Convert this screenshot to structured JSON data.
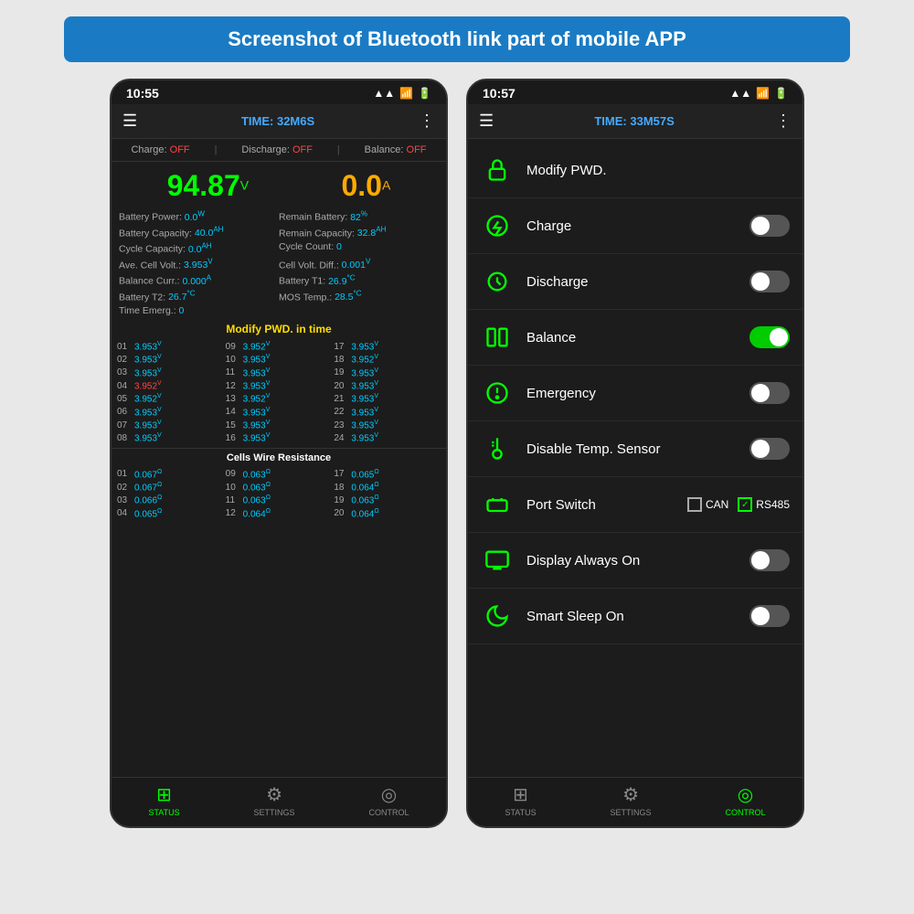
{
  "banner": {
    "text": "Screenshot of Bluetooth link part of mobile APP"
  },
  "phone_left": {
    "status_bar": {
      "time": "10:55",
      "signal": "▲▲",
      "wifi": "WiFi",
      "battery": "🔋"
    },
    "header": {
      "menu": "☰",
      "title": "TIME: 32M6S",
      "more": "⋮"
    },
    "status_indicators": [
      {
        "label": "Charge:",
        "value": "OFF"
      },
      {
        "label": "Discharge:",
        "value": "OFF"
      },
      {
        "label": "Balance:",
        "value": "OFF"
      }
    ],
    "voltage": "94.87",
    "voltage_unit": "V",
    "current": "0.0",
    "current_unit": "A",
    "info_items": [
      {
        "label": "Battery Power:",
        "value": "0.0",
        "unit": "W"
      },
      {
        "label": "Remain Battery:",
        "value": "82",
        "unit": "%"
      },
      {
        "label": "Battery Capacity:",
        "value": "40.0",
        "unit": "AH"
      },
      {
        "label": "Remain Capacity:",
        "value": "32.8",
        "unit": "AH"
      },
      {
        "label": "Cycle Capacity:",
        "value": "0.0",
        "unit": "AH"
      },
      {
        "label": "Cycle Count:",
        "value": "0",
        "unit": ""
      },
      {
        "label": "Ave. Cell Volt.:",
        "value": "3.953",
        "unit": "V"
      },
      {
        "label": "Cell Volt. Diff.:",
        "value": "0.001",
        "unit": "V"
      },
      {
        "label": "Balance Curr.:",
        "value": "0.000",
        "unit": "A"
      },
      {
        "label": "Battery T1:",
        "value": "26.9",
        "unit": "°C"
      },
      {
        "label": "Battery T2:",
        "value": "26.7",
        "unit": "°C"
      },
      {
        "label": "MOS Temp.:",
        "value": "28.5",
        "unit": "°C"
      },
      {
        "label": "Time Emerg.:",
        "value": "0",
        "unit": ""
      }
    ],
    "warning": "Modify PWD. in time",
    "cells": [
      {
        "num": "01",
        "val": "3.953",
        "unit": "V",
        "red": false
      },
      {
        "num": "09",
        "val": "3.952",
        "unit": "V",
        "red": false
      },
      {
        "num": "17",
        "val": "3.953",
        "unit": "V",
        "red": false
      },
      {
        "num": "02",
        "val": "3.953",
        "unit": "V",
        "red": false
      },
      {
        "num": "10",
        "val": "3.953",
        "unit": "V",
        "red": false
      },
      {
        "num": "18",
        "val": "3.952",
        "unit": "V",
        "red": false
      },
      {
        "num": "03",
        "val": "3.953",
        "unit": "V",
        "red": false
      },
      {
        "num": "11",
        "val": "3.953",
        "unit": "V",
        "red": false
      },
      {
        "num": "19",
        "val": "3.953",
        "unit": "V",
        "red": false
      },
      {
        "num": "04",
        "val": "3.952",
        "unit": "V",
        "red": true
      },
      {
        "num": "12",
        "val": "3.953",
        "unit": "V",
        "red": false
      },
      {
        "num": "20",
        "val": "3.953",
        "unit": "V",
        "red": false
      },
      {
        "num": "05",
        "val": "3.952",
        "unit": "V",
        "red": false
      },
      {
        "num": "13",
        "val": "3.952",
        "unit": "V",
        "red": false
      },
      {
        "num": "21",
        "val": "3.953",
        "unit": "V",
        "red": false
      },
      {
        "num": "06",
        "val": "3.953",
        "unit": "V",
        "red": false
      },
      {
        "num": "14",
        "val": "3.953",
        "unit": "V",
        "red": false
      },
      {
        "num": "22",
        "val": "3.953",
        "unit": "V",
        "red": false
      },
      {
        "num": "07",
        "val": "3.953",
        "unit": "V",
        "red": false
      },
      {
        "num": "15",
        "val": "3.953",
        "unit": "V",
        "red": false
      },
      {
        "num": "23",
        "val": "3.953",
        "unit": "V",
        "red": false
      },
      {
        "num": "08",
        "val": "3.953",
        "unit": "V",
        "red": false
      },
      {
        "num": "16",
        "val": "3.953",
        "unit": "V",
        "red": false
      },
      {
        "num": "24",
        "val": "3.953",
        "unit": "V",
        "red": false
      }
    ],
    "resistance_title": "Cells Wire Resistance",
    "resistances": [
      {
        "num": "01",
        "val": "0.067",
        "unit": "Ω"
      },
      {
        "num": "09",
        "val": "0.063",
        "unit": "Ω"
      },
      {
        "num": "17",
        "val": "0.065",
        "unit": "Ω"
      },
      {
        "num": "02",
        "val": "0.067",
        "unit": "Ω"
      },
      {
        "num": "10",
        "val": "0.063",
        "unit": "Ω"
      },
      {
        "num": "18",
        "val": "0.064",
        "unit": "Ω"
      },
      {
        "num": "03",
        "val": "0.066",
        "unit": "Ω"
      },
      {
        "num": "11",
        "val": "0.063",
        "unit": "Ω"
      },
      {
        "num": "19",
        "val": "0.063",
        "unit": "Ω"
      },
      {
        "num": "04",
        "val": "0.065",
        "unit": "Ω"
      },
      {
        "num": "12",
        "val": "0.064",
        "unit": "Ω"
      },
      {
        "num": "20",
        "val": "0.064",
        "unit": "Ω"
      }
    ],
    "nav": [
      {
        "icon": "⊞",
        "label": "STATUS",
        "active": true
      },
      {
        "icon": "⚙",
        "label": "SETTINGS",
        "active": false
      },
      {
        "icon": "◎",
        "label": "CONTROL",
        "active": false
      }
    ]
  },
  "phone_right": {
    "status_bar": {
      "time": "10:57"
    },
    "header": {
      "title": "TIME: 33M57S"
    },
    "controls": [
      {
        "label": "Modify PWD.",
        "type": "lock",
        "toggle": null
      },
      {
        "label": "Charge",
        "type": "charge",
        "toggle": "off"
      },
      {
        "label": "Discharge",
        "type": "discharge",
        "toggle": "off"
      },
      {
        "label": "Balance",
        "type": "balance",
        "toggle": "on"
      },
      {
        "label": "Emergency",
        "type": "emergency",
        "toggle": "off"
      },
      {
        "label": "Disable Temp. Sensor",
        "type": "temp",
        "toggle": "off"
      },
      {
        "label": "Port Switch",
        "type": "port",
        "toggle": null,
        "can": false,
        "rs485": true
      },
      {
        "label": "Display Always On",
        "type": "display",
        "toggle": "off"
      },
      {
        "label": "Smart Sleep On",
        "type": "sleep",
        "toggle": "off"
      }
    ],
    "nav": [
      {
        "icon": "⊞",
        "label": "STATUS",
        "active": false
      },
      {
        "icon": "⚙",
        "label": "SETTINGS",
        "active": false
      },
      {
        "icon": "◎",
        "label": "CONTROL",
        "active": true
      }
    ]
  }
}
